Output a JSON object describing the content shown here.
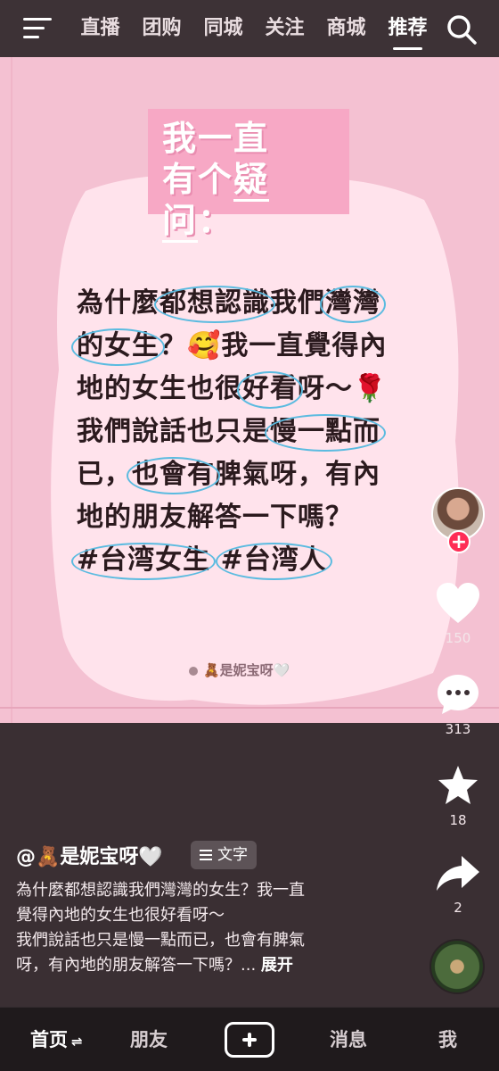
{
  "top_tabs": [
    "直播",
    "团购",
    "同城",
    "关注",
    "商城",
    "推荐"
  ],
  "active_tab": "推荐",
  "post_image": {
    "title_line1": "我一直",
    "title_line2_a": "有个",
    "title_line2_b": "疑问",
    "title_line2_c": "：",
    "body": {
      "l1a": "為什麼",
      "l1b": "都想認識",
      "l1c": "我們",
      "l1d": "灣灣",
      "l2a": "的女生",
      "l2b": "？🥰我一直覺得內",
      "l3a": "地的女生也很",
      "l3b": "好看",
      "l3c": "呀～🌹",
      "l4a": "我們說話也只是",
      "l4b": "慢一點而",
      "l5a": "已，",
      "l5b": "也會有",
      "l5c": "脾氣呀，有內",
      "l6": "地的朋友解答一下嗎？",
      "l7a": "#台湾女生",
      "l7b": "#台湾人"
    },
    "watermark": "🧸是妮宝呀🤍"
  },
  "actions": {
    "like_count": "150",
    "comment_count": "313",
    "favorite_count": "18",
    "share_count": "2"
  },
  "author": "@🧸是妮宝呀🤍",
  "text_tag": "文字",
  "caption": {
    "line1": "為什麼都想認識我們灣灣的女生？我一直",
    "line2": "覺得內地的女生也很好看呀～",
    "line3": "我們說話也只是慢一點而已，也會有脾氣",
    "line4": "呀，有內地的朋友解答一下嗎？...",
    "expand": "展开"
  },
  "bottom_nav": {
    "home": "首页",
    "home_toggle": "⇌",
    "friends": "朋友",
    "messages": "消息",
    "me": "我"
  },
  "colors": {
    "post_bg": "#f4c1d2",
    "title_box": "#f7a8c5",
    "highlight_circle": "#5bbbe0",
    "follow_red": "#fe2c55"
  }
}
